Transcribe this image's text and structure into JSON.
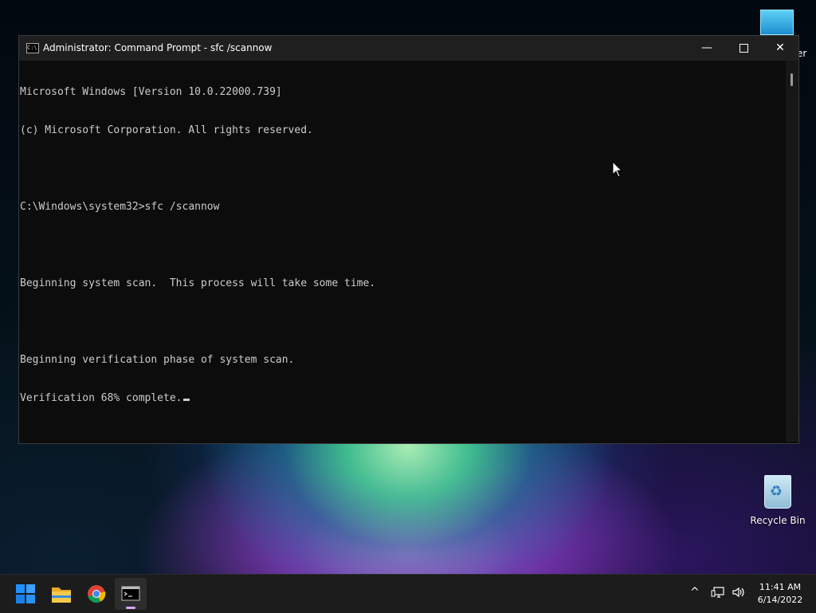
{
  "desktop": {
    "icons": {
      "monitor_partial_label": "er",
      "recycle_bin_label": "Recycle Bin"
    }
  },
  "window": {
    "title": "Administrator: Command Prompt - sfc  /scannow",
    "title_icon_text": "C:\\",
    "console_lines": [
      "Microsoft Windows [Version 10.0.22000.739]",
      "(c) Microsoft Corporation. All rights reserved.",
      "",
      "C:\\Windows\\system32>sfc /scannow",
      "",
      "Beginning system scan.  This process will take some time.",
      "",
      "Beginning verification phase of system scan.",
      "Verification 68% complete."
    ],
    "minimize_glyph": "—",
    "close_glyph": "✕"
  },
  "taskbar": {
    "items": [
      {
        "name": "start-icon"
      },
      {
        "name": "file-explorer-icon"
      },
      {
        "name": "chrome-icon"
      },
      {
        "name": "command-prompt-icon",
        "active": true
      }
    ],
    "tray": {
      "chevron_glyph": "^",
      "clock_time": "11:41 AM",
      "clock_date": "6/14/2022"
    }
  },
  "colors": {
    "console_bg": "#0c0c0c",
    "console_text": "#cccccc",
    "titlebar_bg": "#1f1f1f",
    "taskbar_bg": "#1c1c1c",
    "accent_start": "#1e90ff"
  }
}
